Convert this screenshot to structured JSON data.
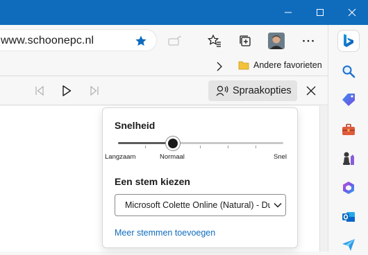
{
  "window": {
    "title_bar_color": "#0f6cbd",
    "controls": [
      {
        "name": "minimize-icon"
      },
      {
        "name": "maximize-icon"
      },
      {
        "name": "close-window-icon"
      }
    ]
  },
  "toolbar": {
    "url": "www.schoonepc.nl",
    "icons": [
      "favorite-star-icon",
      "read-aloud-disabled-icon",
      "favorites-list-icon",
      "collections-icon",
      "profile-avatar",
      "more-menu-icon",
      "bing-copilot-icon"
    ],
    "star_color": "#0f6cbd"
  },
  "favorites_bar": {
    "other_favorites_label": "Andere favorieten",
    "folder_color": "#f2c23a"
  },
  "read_aloud": {
    "voice_options_label": "Spraakopties"
  },
  "voice_panel": {
    "speed_heading": "Snelheid",
    "speed_labels": {
      "slow": "Langzaam",
      "normal": "Normaal",
      "fast": "Snel"
    },
    "speed_value_fraction": 0.33,
    "voice_heading": "Een stem kiezen",
    "selected_voice": "Microsoft Colette Online (Natural) - Dutch (Netherlands)",
    "more_voices_link": "Meer stemmen toevoegen",
    "link_color": "#0f6cbd"
  },
  "sidebar": {
    "icons": [
      "search-icon",
      "shopping-tag-icon",
      "tools-icon",
      "games-icon",
      "microsoft-365-icon",
      "outlook-icon",
      "send-icon"
    ]
  }
}
